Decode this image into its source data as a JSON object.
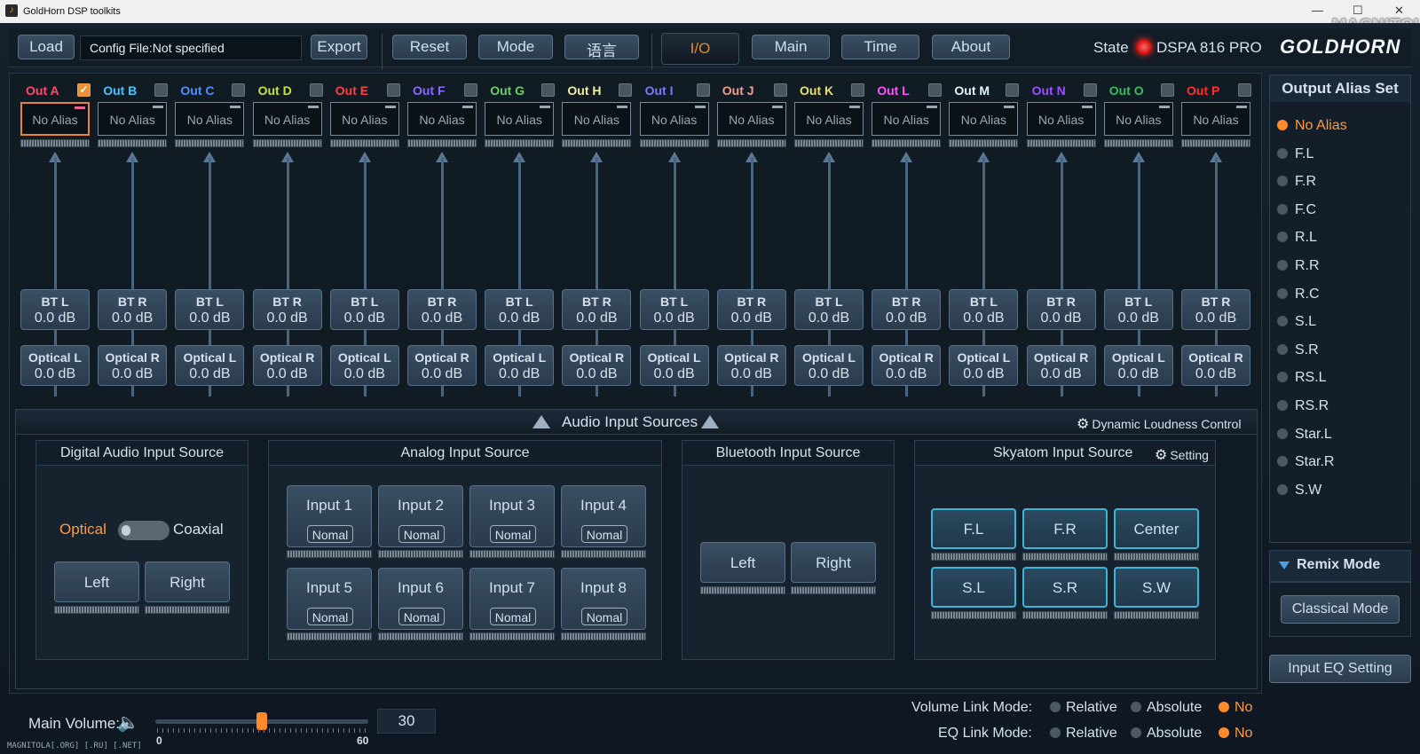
{
  "window": {
    "title": "GoldHorn DSP toolkits",
    "minimize": "—",
    "maximize": "☐",
    "close": "✕"
  },
  "watermark": "MAGNITOLA",
  "toolbar": {
    "load": "Load",
    "config_file": "Config File:Not specified",
    "export": "Export",
    "reset": "Reset",
    "mode": "Mode",
    "language": "语言",
    "tabs": [
      "I/O",
      "Main",
      "Time",
      "About"
    ],
    "active_tab": "I/O",
    "state_label": "State",
    "state_color": "#e01a1a",
    "model": "DSPA 816 PRO",
    "logo": "GOLDHORN"
  },
  "outputs": [
    {
      "name": "Out  A",
      "color": "#ff4a6a",
      "checked": true,
      "alias": "No Alias",
      "bt": "BT L",
      "bt_db": "0.0 dB",
      "opt": "Optical L",
      "opt_db": "0.0 dB"
    },
    {
      "name": "Out  B",
      "color": "#3cc8ff",
      "checked": false,
      "alias": "No Alias",
      "bt": "BT R",
      "bt_db": "0.0 dB",
      "opt": "Optical R",
      "opt_db": "0.0 dB"
    },
    {
      "name": "Out  C",
      "color": "#4a90ff",
      "checked": false,
      "alias": "No Alias",
      "bt": "BT L",
      "bt_db": "0.0 dB",
      "opt": "Optical L",
      "opt_db": "0.0 dB"
    },
    {
      "name": "Out  D",
      "color": "#c8e040",
      "checked": false,
      "alias": "No Alias",
      "bt": "BT R",
      "bt_db": "0.0 dB",
      "opt": "Optical R",
      "opt_db": "0.0 dB"
    },
    {
      "name": "Out  E",
      "color": "#ff4040",
      "checked": false,
      "alias": "No Alias",
      "bt": "BT L",
      "bt_db": "0.0 dB",
      "opt": "Optical L",
      "opt_db": "0.0 dB"
    },
    {
      "name": "Out  F",
      "color": "#8a6aff",
      "checked": false,
      "alias": "No Alias",
      "bt": "BT R",
      "bt_db": "0.0 dB",
      "opt": "Optical R",
      "opt_db": "0.0 dB"
    },
    {
      "name": "Out  G",
      "color": "#6ad060",
      "checked": false,
      "alias": "No Alias",
      "bt": "BT L",
      "bt_db": "0.0 dB",
      "opt": "Optical L",
      "opt_db": "0.0 dB"
    },
    {
      "name": "Out  H",
      "color": "#f0f0a0",
      "checked": false,
      "alias": "No Alias",
      "bt": "BT R",
      "bt_db": "0.0 dB",
      "opt": "Optical R",
      "opt_db": "0.0 dB"
    },
    {
      "name": "Out  I",
      "color": "#7a7aff",
      "checked": false,
      "alias": "No Alias",
      "bt": "BT L",
      "bt_db": "0.0 dB",
      "opt": "Optical L",
      "opt_db": "0.0 dB"
    },
    {
      "name": "Out  J",
      "color": "#f0a090",
      "checked": false,
      "alias": "No Alias",
      "bt": "BT R",
      "bt_db": "0.0 dB",
      "opt": "Optical R",
      "opt_db": "0.0 dB"
    },
    {
      "name": "Out  K",
      "color": "#e8e070",
      "checked": false,
      "alias": "No Alias",
      "bt": "BT L",
      "bt_db": "0.0 dB",
      "opt": "Optical L",
      "opt_db": "0.0 dB"
    },
    {
      "name": "Out  L",
      "color": "#ff50ff",
      "checked": false,
      "alias": "No Alias",
      "bt": "BT R",
      "bt_db": "0.0 dB",
      "opt": "Optical R",
      "opt_db": "0.0 dB"
    },
    {
      "name": "Out  M",
      "color": "#e0f8ff",
      "checked": false,
      "alias": "No Alias",
      "bt": "BT L",
      "bt_db": "0.0 dB",
      "opt": "Optical L",
      "opt_db": "0.0 dB"
    },
    {
      "name": "Out  N",
      "color": "#9a50ff",
      "checked": false,
      "alias": "No Alias",
      "bt": "BT R",
      "bt_db": "0.0 dB",
      "opt": "Optical R",
      "opt_db": "0.0 dB"
    },
    {
      "name": "Out  O",
      "color": "#30c060",
      "checked": false,
      "alias": "No Alias",
      "bt": "BT L",
      "bt_db": "0.0 dB",
      "opt": "Optical L",
      "opt_db": "0.0 dB"
    },
    {
      "name": "Out  P",
      "color": "#ff3030",
      "checked": false,
      "alias": "No Alias",
      "bt": "BT R",
      "bt_db": "0.0 dB",
      "opt": "Optical R",
      "opt_db": "0.0 dB"
    }
  ],
  "input_sources": {
    "title": "Audio Input Sources",
    "dynamic_loudness": "Dynamic Loudness Control",
    "digital": {
      "title": "Digital Audio Input Source",
      "optical": "Optical",
      "coaxial": "Coaxial",
      "left": "Left",
      "right": "Right"
    },
    "analog": {
      "title": "Analog Input Source",
      "inputs": [
        {
          "label": "Input 1",
          "mode": "Nomal"
        },
        {
          "label": "Input 2",
          "mode": "Nomal"
        },
        {
          "label": "Input 3",
          "mode": "Nomal"
        },
        {
          "label": "Input 4",
          "mode": "Nomal"
        },
        {
          "label": "Input 5",
          "mode": "Nomal"
        },
        {
          "label": "Input 6",
          "mode": "Nomal"
        },
        {
          "label": "Input 7",
          "mode": "Nomal"
        },
        {
          "label": "Input 8",
          "mode": "Nomal"
        }
      ]
    },
    "bluetooth": {
      "title": "Bluetooth Input Source",
      "left": "Left",
      "right": "Right"
    },
    "skyatom": {
      "title": "Skyatom Input Source",
      "setting": "Setting",
      "channels": [
        "F.L",
        "F.R",
        "Center",
        "S.L",
        "S.R",
        "S.W"
      ]
    }
  },
  "alias_panel": {
    "title": "Output Alias Set",
    "items": [
      "No Alias",
      "F.L",
      "F.R",
      "F.C",
      "R.L",
      "R.R",
      "R.C",
      "S.L",
      "S.R",
      "RS.L",
      "RS.R",
      "Star.L",
      "Star.R",
      "S.W"
    ],
    "selected": "No Alias"
  },
  "remix": {
    "title": "Remix Mode",
    "mode": "Classical Mode"
  },
  "input_eq": "Input EQ Setting",
  "volume": {
    "label": "Main Volume:",
    "value": "30",
    "min": "0",
    "max": "60",
    "level": 0.5
  },
  "volume_link": {
    "label": "Volume Link Mode:",
    "options": [
      "Relative",
      "Absolute",
      "No"
    ],
    "selected": "No"
  },
  "eq_link": {
    "label": "EQ Link Mode:",
    "options": [
      "Relative",
      "Absolute",
      "No"
    ],
    "selected": "No"
  },
  "footer_watermark": "MAGNITOLA[.ORG] [.RU] [.NET]"
}
